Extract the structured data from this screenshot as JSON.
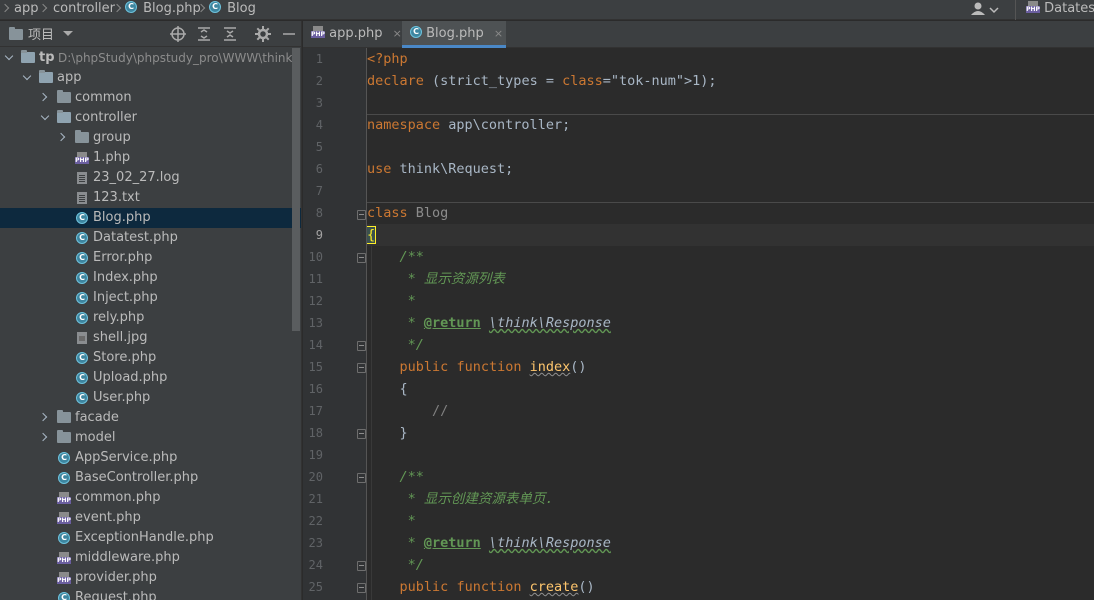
{
  "navbar": {
    "crumbs": [
      {
        "label": "app",
        "icon": "none"
      },
      {
        "label": "controller",
        "icon": "none"
      },
      {
        "label": "Blog.php",
        "icon": "class-c-icon"
      },
      {
        "label": "Blog",
        "icon": "class-c-icon"
      }
    ],
    "run_config": "Datatest"
  },
  "project": {
    "title": "项目",
    "tree": [
      {
        "label": "tp",
        "path": "D:\\phpStudy\\phpstudy_pro\\WWW\\thinkphp",
        "type": "folder",
        "expanded": true
      },
      {
        "label": "app",
        "type": "folder",
        "expanded": true
      },
      {
        "label": "common",
        "type": "folder",
        "expanded": false
      },
      {
        "label": "controller",
        "type": "folder",
        "expanded": true
      },
      {
        "label": "group",
        "type": "folder",
        "expanded": false
      },
      {
        "label": "1.php",
        "type": "php"
      },
      {
        "label": "23_02_27.log",
        "type": "text"
      },
      {
        "label": "123.txt",
        "type": "text"
      },
      {
        "label": "Blog.php",
        "type": "class",
        "selected": true
      },
      {
        "label": "Datatest.php",
        "type": "class"
      },
      {
        "label": "Error.php",
        "type": "class"
      },
      {
        "label": "Index.php",
        "type": "class"
      },
      {
        "label": "Inject.php",
        "type": "class"
      },
      {
        "label": "rely.php",
        "type": "class"
      },
      {
        "label": "shell.jpg",
        "type": "image"
      },
      {
        "label": "Store.php",
        "type": "class"
      },
      {
        "label": "Upload.php",
        "type": "class"
      },
      {
        "label": "User.php",
        "type": "class"
      },
      {
        "label": "facade",
        "type": "folder",
        "expanded": false
      },
      {
        "label": "model",
        "type": "folder",
        "expanded": false
      },
      {
        "label": "AppService.php",
        "type": "class"
      },
      {
        "label": "BaseController.php",
        "type": "abstract-class"
      },
      {
        "label": "common.php",
        "type": "php"
      },
      {
        "label": "event.php",
        "type": "php"
      },
      {
        "label": "ExceptionHandle.php",
        "type": "class"
      },
      {
        "label": "middleware.php",
        "type": "php"
      },
      {
        "label": "provider.php",
        "type": "php"
      },
      {
        "label": "Request.php",
        "type": "class"
      }
    ]
  },
  "editor": {
    "tabs": [
      {
        "label": "app.php",
        "icon": "php-icon",
        "active": false,
        "close": "×"
      },
      {
        "label": "Blog.php",
        "icon": "class-c-icon",
        "active": true,
        "close": "×"
      }
    ],
    "current_line": 9,
    "lines": [
      {
        "n": "1",
        "text": "<?php"
      },
      {
        "n": "2",
        "text": "declare (strict_types = 1);"
      },
      {
        "n": "3",
        "text": ""
      },
      {
        "n": "4",
        "text": "namespace app\\controller;"
      },
      {
        "n": "5",
        "text": ""
      },
      {
        "n": "6",
        "text": "use think\\Request;"
      },
      {
        "n": "7",
        "text": ""
      },
      {
        "n": "8",
        "text": "class Blog"
      },
      {
        "n": "9",
        "text": "{"
      },
      {
        "n": "10",
        "text": "    /**"
      },
      {
        "n": "11",
        "text": "     * 显示资源列表"
      },
      {
        "n": "12",
        "text": "     *"
      },
      {
        "n": "13",
        "text": "     * @return \\think\\Response"
      },
      {
        "n": "14",
        "text": "     */"
      },
      {
        "n": "15",
        "text": "    public function index()"
      },
      {
        "n": "16",
        "text": "    {"
      },
      {
        "n": "17",
        "text": "        //"
      },
      {
        "n": "18",
        "text": "    }"
      },
      {
        "n": "19",
        "text": ""
      },
      {
        "n": "20",
        "text": "    /**"
      },
      {
        "n": "21",
        "text": "     * 显示创建资源表单页."
      },
      {
        "n": "22",
        "text": "     *"
      },
      {
        "n": "23",
        "text": "     * @return \\think\\Response"
      },
      {
        "n": "24",
        "text": "     */"
      },
      {
        "n": "25",
        "text": "    public function create()"
      }
    ]
  },
  "colors": {
    "keyword": "#cc7832",
    "number": "#6897bb",
    "function": "#ffc66d",
    "doc_comment": "#629755",
    "line_comment": "#808080",
    "selection": "#0d293e",
    "tab_accent": "#4a88c7"
  }
}
